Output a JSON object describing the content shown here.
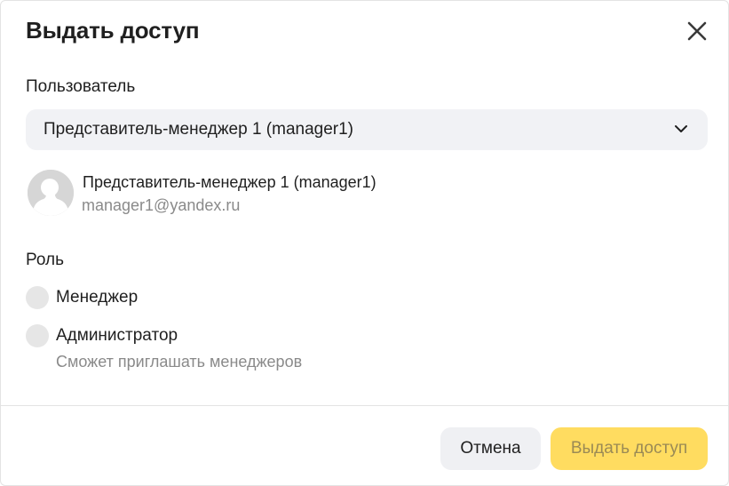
{
  "dialog": {
    "title": "Выдать доступ",
    "close_icon": "close-icon"
  },
  "user_field": {
    "label": "Пользователь",
    "selected_value": "Представитель-менеджер 1 (manager1)",
    "chevron_icon": "chevron-down-icon"
  },
  "user_card": {
    "avatar_icon": "user-avatar-icon",
    "name": "Представитель-менеджер 1 (manager1)",
    "email": "manager1@yandex.ru"
  },
  "role": {
    "label": "Роль",
    "options": [
      {
        "label": "Менеджер",
        "selected": false
      },
      {
        "label": "Администратор",
        "selected": false,
        "hint": "Сможет приглашать менеджеров"
      }
    ]
  },
  "footer": {
    "cancel_label": "Отмена",
    "submit_label": "Выдать доступ",
    "submit_color": "#ffdc60"
  }
}
